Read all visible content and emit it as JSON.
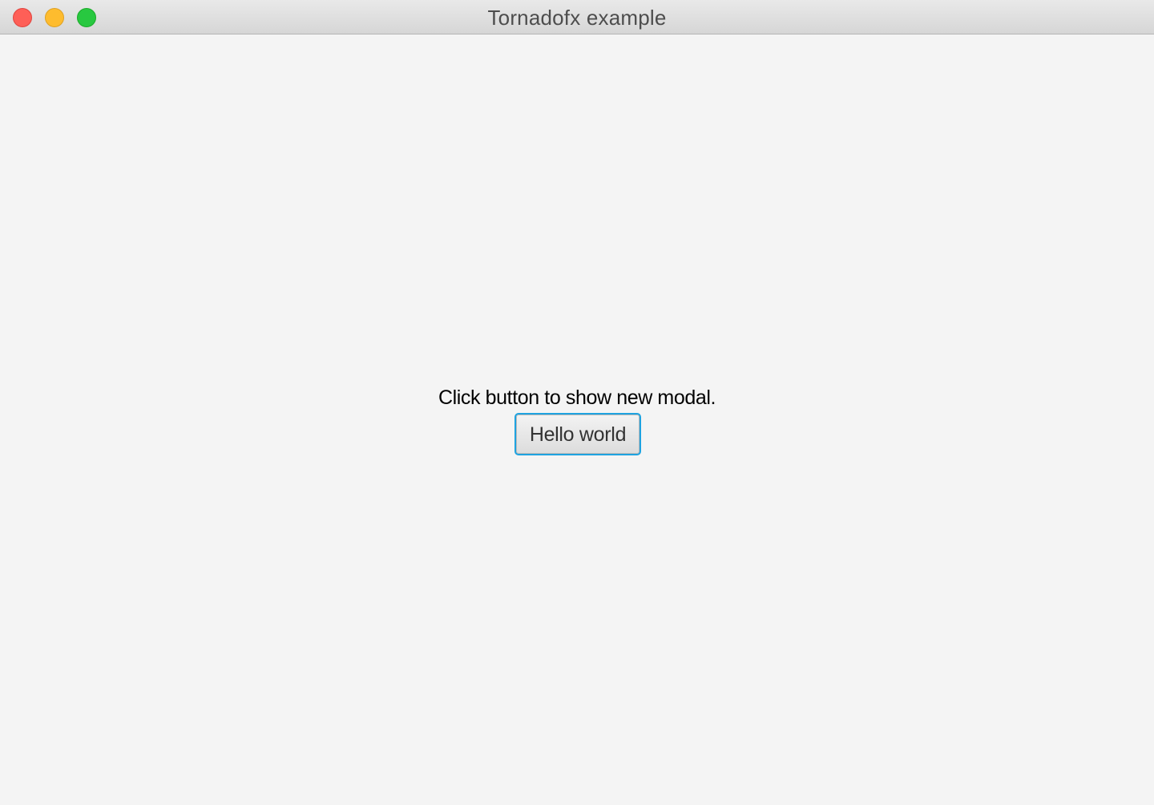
{
  "window": {
    "title": "Tornadofx example",
    "controls": {
      "close_icon": "close-traffic-light",
      "minimize_icon": "minimize-traffic-light",
      "zoom_icon": "zoom-traffic-light",
      "close_color": "#fe5f57",
      "minimize_color": "#febc2e",
      "zoom_color": "#28c840"
    }
  },
  "main": {
    "prompt_text": "Click button to show new modal.",
    "button_label": "Hello world",
    "button_focus_color": "#1fa3e0"
  }
}
